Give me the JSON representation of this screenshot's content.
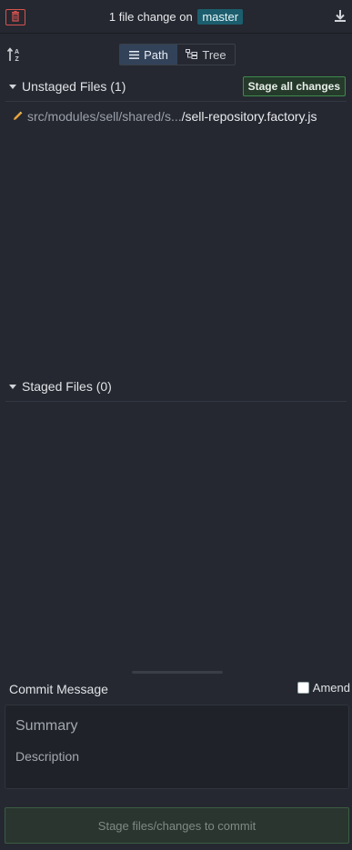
{
  "topbar": {
    "change_text": "1 file change on",
    "branch": "master",
    "trash_icon": "trash-icon",
    "download_icon": "download-icon"
  },
  "toolbar": {
    "sort_icon": "sort-az-icon",
    "views": [
      {
        "label": "Path",
        "icon": "list-icon",
        "active": true
      },
      {
        "label": "Tree",
        "icon": "tree-icon",
        "active": false
      }
    ]
  },
  "unstaged": {
    "title": "Unstaged Files (1)",
    "stage_all_label": "Stage all changes",
    "files": [
      {
        "icon": "pencil-icon",
        "path": "src/modules/sell/shared/s...",
        "name": "/sell-repository.factory.js"
      }
    ]
  },
  "staged": {
    "title": "Staged Files (0)"
  },
  "commit": {
    "label": "Commit Message",
    "amend_label": "Amend",
    "amend_checked": false,
    "summary_placeholder": "Summary",
    "description_placeholder": "Description",
    "button_label": "Stage files/changes to commit"
  },
  "colors": {
    "background": "#252830",
    "branch_badge": "#1c5e6e",
    "stage_green": "#3f8a4e",
    "trash_red": "#d9534f"
  }
}
